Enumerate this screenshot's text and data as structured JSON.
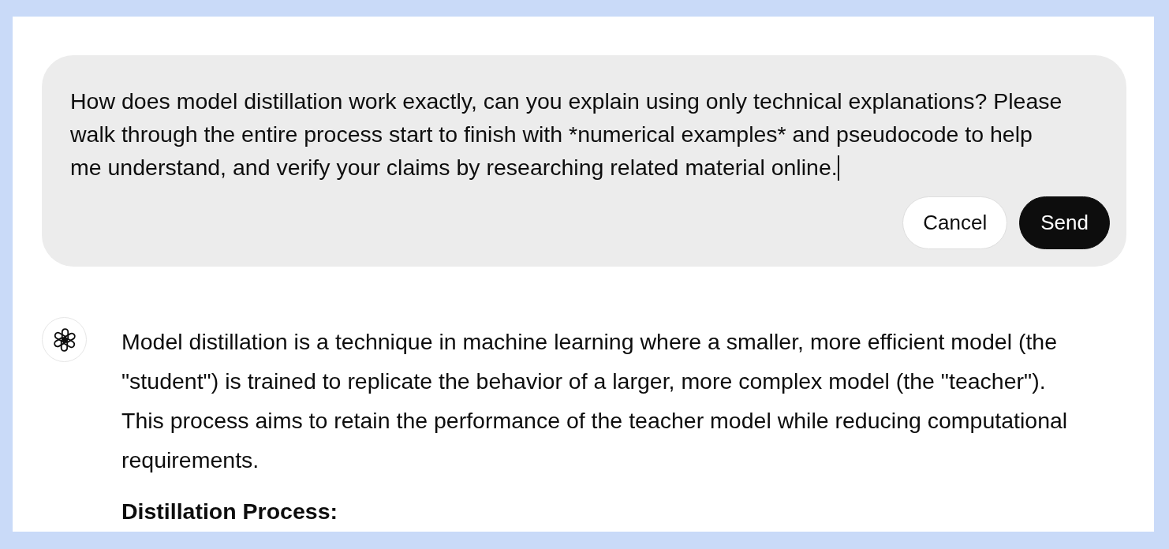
{
  "edit_message": {
    "value": "How does model distillation work exactly, can you explain using only technical explanations? Please walk through the entire process start to finish with *numerical examples* and pseudocode to help me understand, and verify your claims by researching related material online.",
    "focused": true
  },
  "buttons": [
    {
      "label": "Cancel",
      "kind": "secondary"
    },
    {
      "label": "Send",
      "kind": "primary"
    }
  ],
  "response": {
    "blocks": [
      {
        "kind": "paragraph",
        "text": "Model distillation is a technique in machine learning where a smaller, more efficient model (the \"student\") is trained to replicate the behavior of a larger, more complex model (the \"teacher\"). This process aims to retain the performance of the teacher model while reducing computational requirements."
      },
      {
        "kind": "heading",
        "text": "Distillation Process:"
      }
    ]
  }
}
